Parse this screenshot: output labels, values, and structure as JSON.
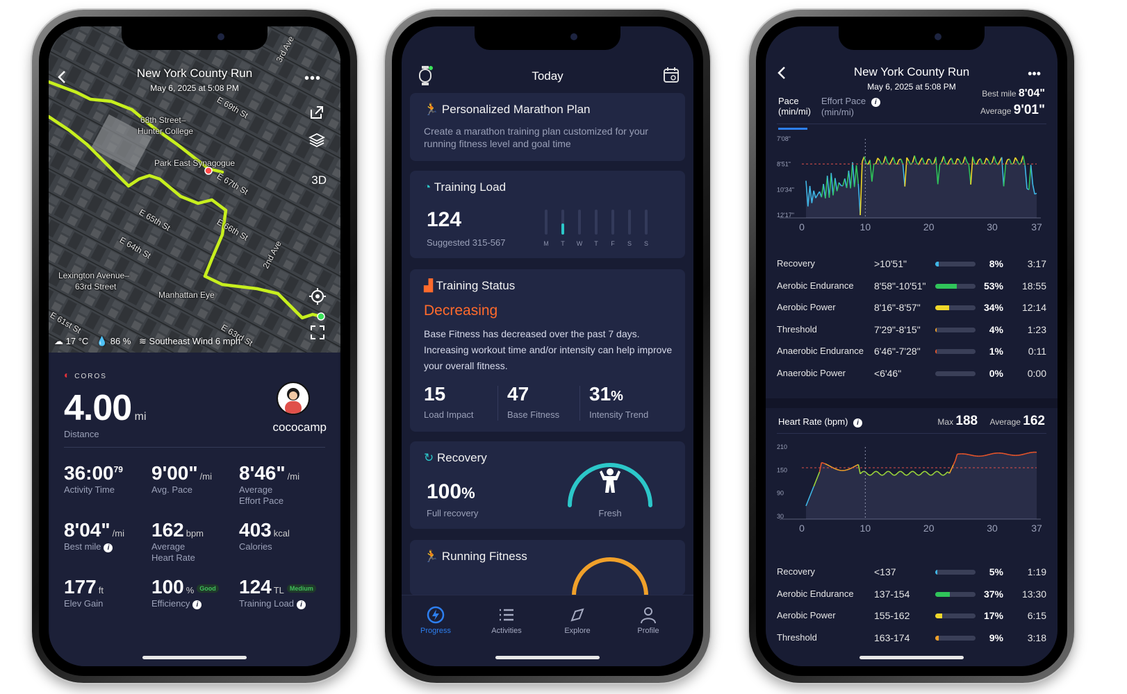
{
  "phone1": {
    "title": "New York County Run",
    "date": "May 6, 2025 at 5:08 PM",
    "map_labels": [
      "68th Street–",
      "Hunter College",
      "Park East Synagogue",
      "E 69th St",
      "E 67th St",
      "E 65th St",
      "E 66th St",
      "E 64th St",
      "Lexington Avenue–",
      "63rd Street",
      "Manhattan Eye",
      "2nd Ave",
      "3rd Ave",
      "E 61st St",
      "E 63rd St"
    ],
    "map_3d": "3D",
    "weather": {
      "temp": "17 °C",
      "humidity": "86 %",
      "wind": "Southeast Wind 6 mph"
    },
    "brand": "COROS",
    "distance": {
      "value": "4.00",
      "unit": "mi",
      "label": "Distance"
    },
    "username": "cococamp",
    "stats": [
      {
        "value": "36:00",
        "sup": "79",
        "unit": "",
        "label": "Activity Time",
        "label2": ""
      },
      {
        "value": "9'00\"",
        "sup": "",
        "unit": "/mi",
        "label": "Avg. Pace",
        "label2": ""
      },
      {
        "value": "8'46\"",
        "sup": "",
        "unit": "/mi",
        "label": "Average",
        "label2": "Effort Pace"
      },
      {
        "value": "8'04\"",
        "sup": "",
        "unit": "/mi",
        "label": "Best mile",
        "label2": ""
      },
      {
        "value": "162",
        "sup": "",
        "unit": "bpm",
        "label": "Average",
        "label2": "Heart Rate"
      },
      {
        "value": "403",
        "sup": "",
        "unit": "kcal",
        "label": "Calories",
        "label2": ""
      },
      {
        "value": "177",
        "sup": "",
        "unit": "ft",
        "label": "Elev Gain",
        "label2": ""
      },
      {
        "value": "100",
        "sup": "",
        "unit": "%",
        "label": "Efficiency",
        "label2": "",
        "badge": "Good"
      },
      {
        "value": "124",
        "sup": "",
        "unit": "TL",
        "label": "Training Load",
        "label2": "",
        "badge": "Medium"
      }
    ],
    "colors": {
      "route": "#c7ef1e",
      "card": "#1c2038"
    }
  },
  "phone2": {
    "header": "Today",
    "marathon": {
      "title": "Personalized Marathon Plan",
      "desc": "Create a marathon training plan customized for your running fitness level and goal time"
    },
    "training_load": {
      "title": "Training Load",
      "value": "124",
      "suggested": "Suggested 315-567",
      "days": [
        "M",
        "T",
        "W",
        "T",
        "F",
        "S",
        "S"
      ],
      "active_day": 1
    },
    "training_status": {
      "title": "Training Status",
      "status": "Decreasing",
      "desc": "Base Fitness has decreased over the past 7 days. Increasing workout time and/or intensity can help improve your overall fitness.",
      "metrics": [
        {
          "value": "15",
          "unit": "",
          "label": "Load Impact"
        },
        {
          "value": "47",
          "unit": "",
          "label": "Base Fitness"
        },
        {
          "value": "31",
          "unit": "%",
          "label": "Intensity Trend"
        }
      ]
    },
    "recovery": {
      "title": "Recovery",
      "value": "100",
      "unit": "%",
      "label": "Full recovery",
      "state": "Fresh"
    },
    "running_fitness": {
      "title": "Running Fitness"
    },
    "tabs": [
      "Progress",
      "Activities",
      "Explore",
      "Profile"
    ],
    "colors": {
      "status": "#ff6a2c",
      "accent": "#2d7ff0",
      "recovery": "#2cc7c9"
    }
  },
  "phone3": {
    "title": "New York County Run",
    "date": "May 6, 2025 at 5:08 PM",
    "pace_tab": "Pace",
    "pace_unit": "(min/mi)",
    "effort_tab": "Effort Pace",
    "effort_unit": "(min/mi)",
    "best_mile_label": "Best mile",
    "best_mile_value": "8'04\"",
    "average_label": "Average",
    "average_value": "9'01\"",
    "pace_chart": {
      "type": "line",
      "yticks": [
        "7'08\"",
        "8'51\"",
        "10'34\"",
        "12'17\""
      ],
      "xticks": [
        "0",
        "10",
        "20",
        "30",
        "37"
      ]
    },
    "pace_zones": [
      {
        "name": "Recovery",
        "range": ">10'51\"",
        "pct": "8%",
        "fill": 0.08,
        "color": "#3fb6e6",
        "time": "3:17"
      },
      {
        "name": "Aerobic Endurance",
        "range": "8'58\"-10'51\"",
        "pct": "53%",
        "fill": 0.53,
        "color": "#30c45a",
        "time": "18:55"
      },
      {
        "name": "Aerobic Power",
        "range": "8'16\"-8'57\"",
        "pct": "34%",
        "fill": 0.34,
        "color": "#f0d72a",
        "time": "12:14"
      },
      {
        "name": "Threshold",
        "range": "7'29\"-8'15\"",
        "pct": "4%",
        "fill": 0.04,
        "color": "#f0a02a",
        "time": "1:23"
      },
      {
        "name": "Anaerobic Endurance",
        "range": "6'46\"-7'28\"",
        "pct": "1%",
        "fill": 0.01,
        "color": "#e5542a",
        "time": "0:11"
      },
      {
        "name": "Anaerobic Power",
        "range": "<6'46\"",
        "pct": "0%",
        "fill": 0.0,
        "color": "#c53030",
        "time": "0:00"
      }
    ],
    "hr_title": "Heart Rate (bpm)",
    "hr_max_label": "Max",
    "hr_max": "188",
    "hr_avg_label": "Average",
    "hr_avg": "162",
    "hr_chart": {
      "type": "line",
      "yticks": [
        "210",
        "150",
        "90",
        "30"
      ],
      "xticks": [
        "0",
        "10",
        "20",
        "30",
        "37"
      ]
    },
    "hr_zones": [
      {
        "name": "Recovery",
        "range": "<137",
        "pct": "5%",
        "fill": 0.05,
        "color": "#3fb6e6",
        "time": "1:19"
      },
      {
        "name": "Aerobic Endurance",
        "range": "137-154",
        "pct": "37%",
        "fill": 0.37,
        "color": "#30c45a",
        "time": "13:30"
      },
      {
        "name": "Aerobic Power",
        "range": "155-162",
        "pct": "17%",
        "fill": 0.17,
        "color": "#f0d72a",
        "time": "6:15"
      },
      {
        "name": "Threshold",
        "range": "163-174",
        "pct": "9%",
        "fill": 0.09,
        "color": "#f0a02a",
        "time": "3:18"
      }
    ]
  }
}
